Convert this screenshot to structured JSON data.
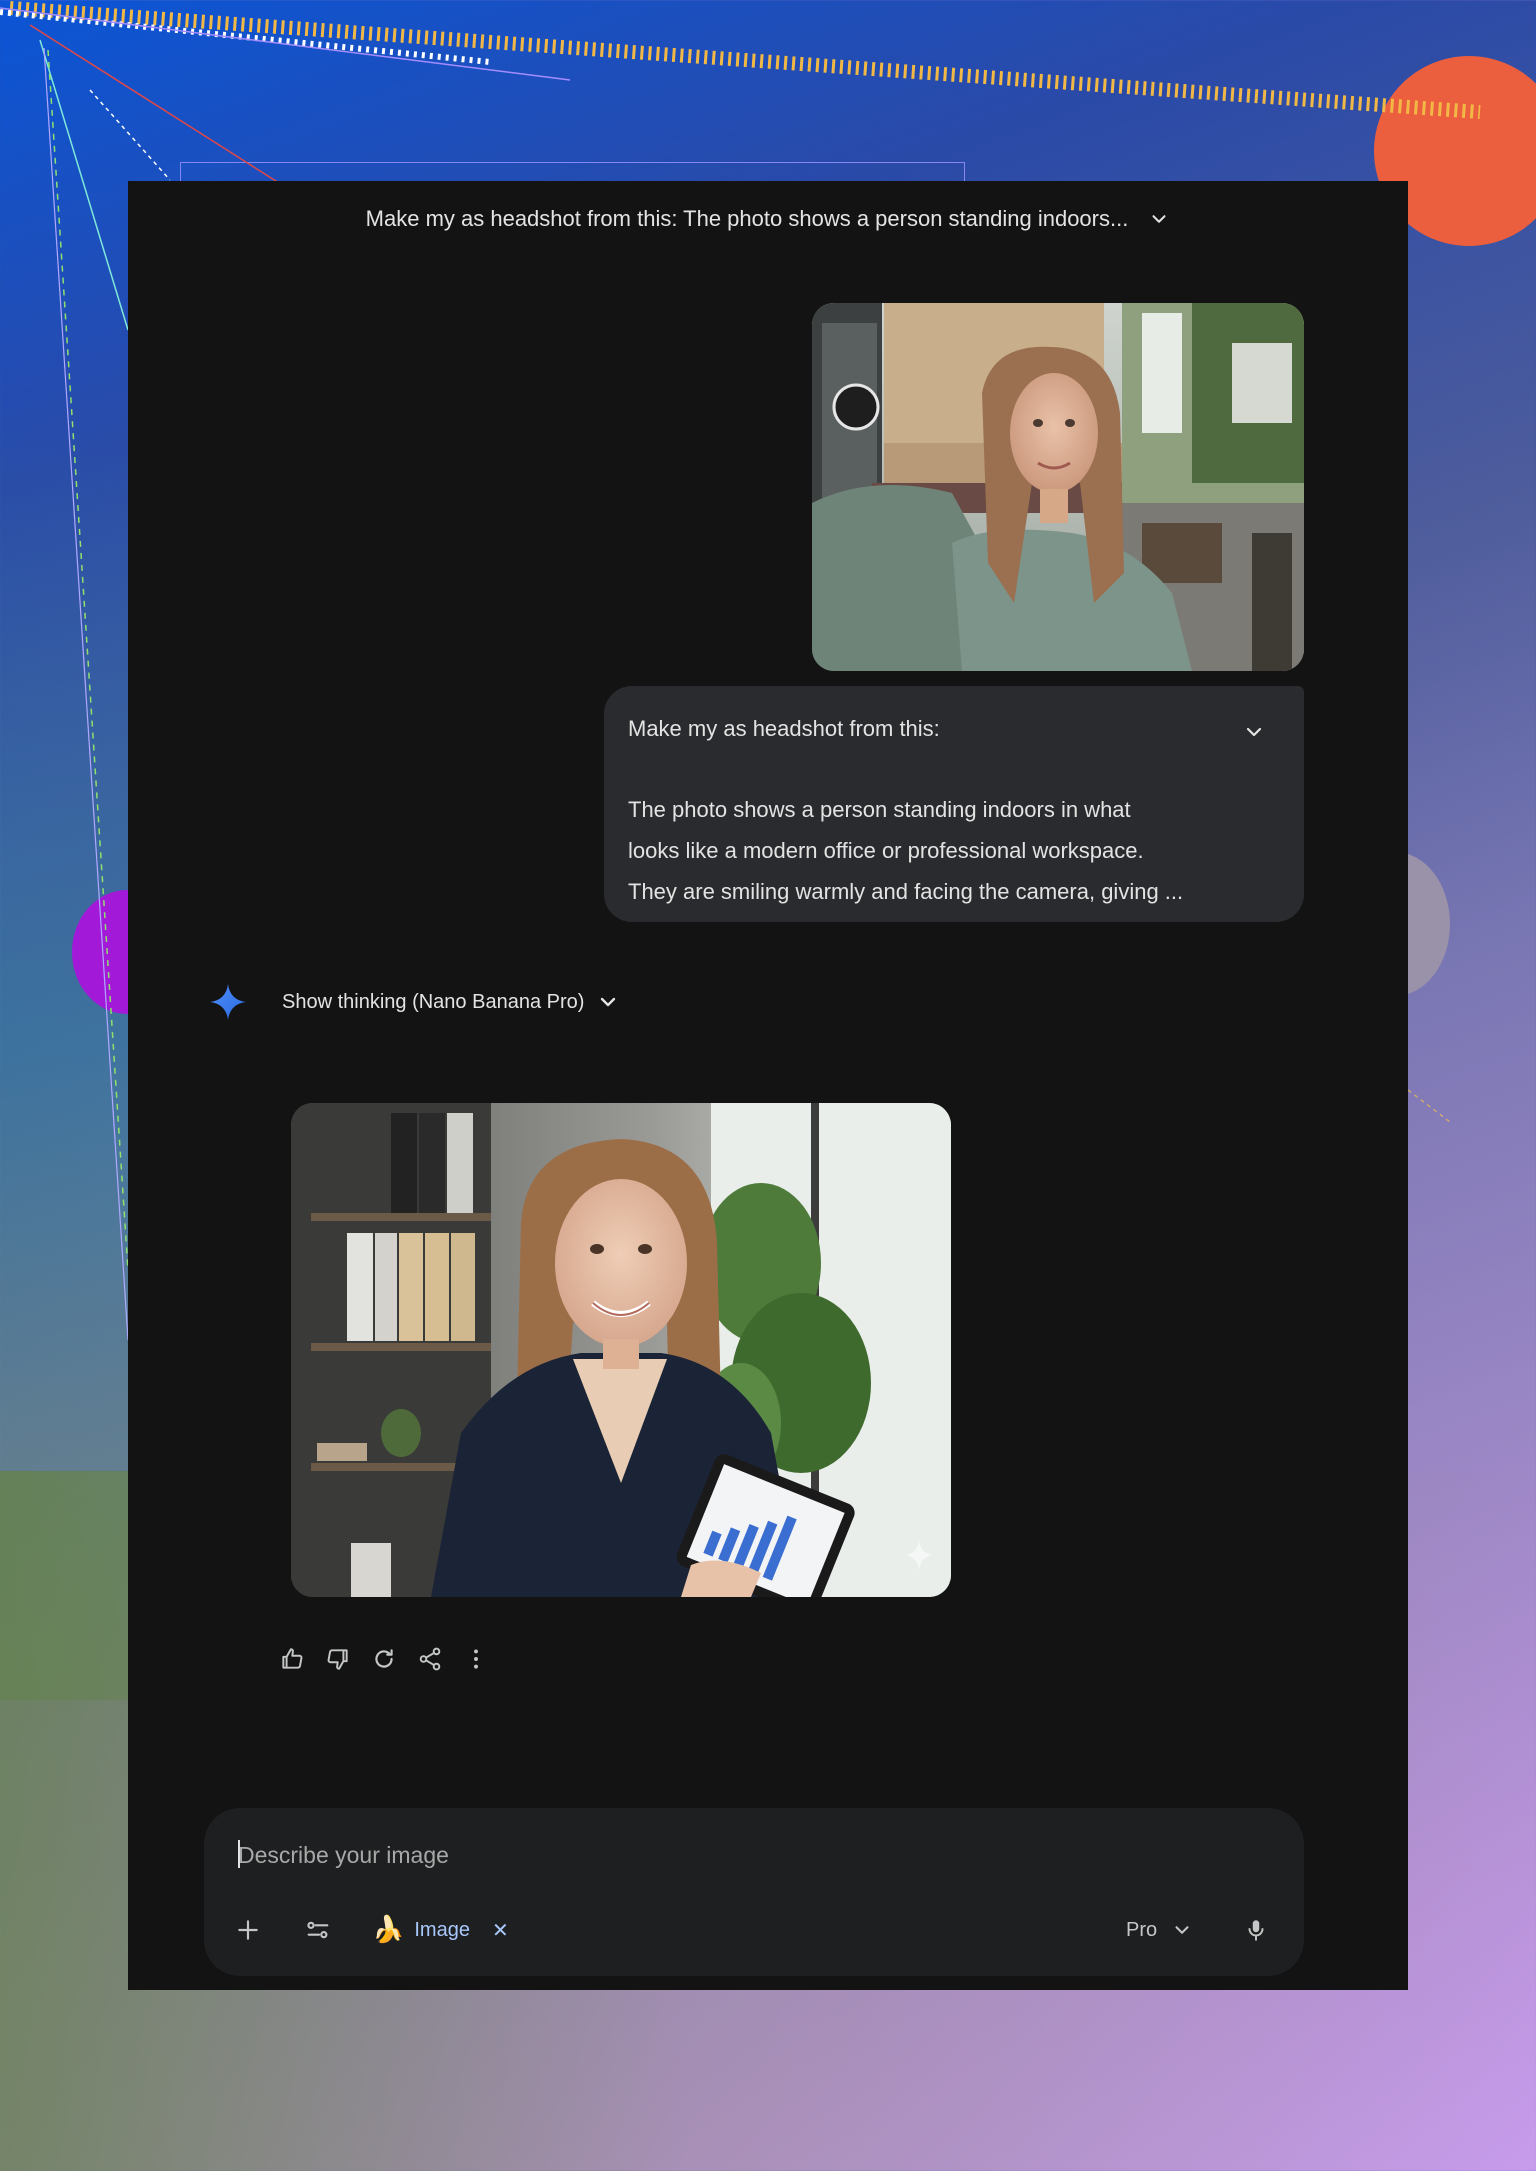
{
  "conversation": {
    "title": "Make my as headshot from this: The photo shows a person standing indoors...",
    "title_menu_icon": "chevron-down-icon"
  },
  "user_message": {
    "image_description": "selfie of a woman with long hair in a green knit sweater on a city sidewalk",
    "line_1": "Make my as headshot from this:",
    "line_2": "The photo shows a person standing indoors in what",
    "line_3": "looks like a modern office or professional workspace.",
    "line_4": "They are smiling warmly and facing the camera, giving ...",
    "expand_icon": "chevron-down-icon"
  },
  "response": {
    "thinking_label": "Show thinking (Nano Banana Pro)",
    "brand_icon": "gemini-spark-icon",
    "image_description": "professional headshot of the woman in a navy blazer holding a tablet in an office",
    "actions": [
      "thumbs-up-icon",
      "thumbs-down-icon",
      "regenerate-icon",
      "share-icon",
      "more-vert-icon"
    ]
  },
  "composer": {
    "placeholder": "Describe your image",
    "value": "",
    "add_icon": "plus-icon",
    "tools_icon": "tune-icon",
    "tool_chip": {
      "emoji": "🍌",
      "label": "Image",
      "close": "✕"
    },
    "model": "Pro",
    "mic_icon": "mic-icon"
  },
  "colors": {
    "app_background": "#131314",
    "bubble": "#2a2b2e",
    "composer": "#1e1f20",
    "accent_blue": "#a8c7fa",
    "spark_blue": "#4285f4"
  }
}
